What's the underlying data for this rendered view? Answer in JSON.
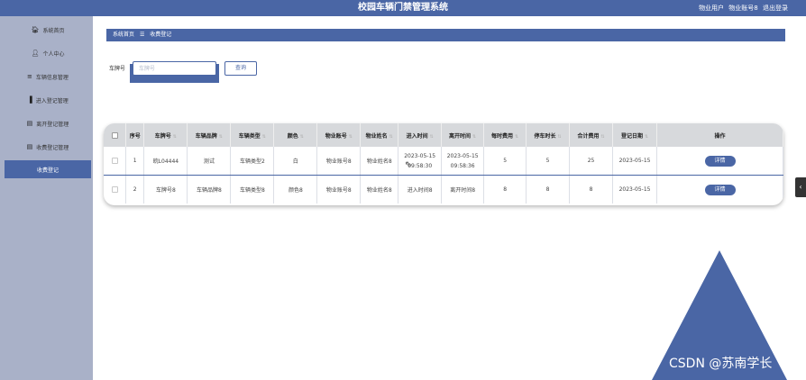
{
  "header": {
    "title": "校园车辆门禁管理系统",
    "user_role": "物业用户",
    "user_name": "物业账号8",
    "logout": "退出登录"
  },
  "sidebar": {
    "items": [
      {
        "label": "系统首页",
        "icon": "home-icon",
        "glyph": "🏠︎"
      },
      {
        "label": "个人中心",
        "icon": "person-icon",
        "glyph": "👤︎"
      },
      {
        "label": "车辆信息管理",
        "icon": "list-icon",
        "glyph": "≡"
      },
      {
        "label": "进入登记管理",
        "icon": "bar-chart-icon",
        "glyph": "▐"
      },
      {
        "label": "离开登记管理",
        "icon": "clipboard-icon",
        "glyph": "▤"
      },
      {
        "label": "收费登记管理",
        "icon": "clipboard-icon",
        "glyph": "▤"
      },
      {
        "label": "收费登记",
        "icon": "",
        "glyph": ""
      }
    ]
  },
  "breadcrumb": {
    "home": "系统首页",
    "sep": "☰",
    "current": "收费登记"
  },
  "search": {
    "label": "车牌号",
    "placeholder": "车牌号",
    "value": "",
    "button": "查询"
  },
  "table": {
    "headers": [
      "序号",
      "车牌号",
      "车辆品牌",
      "车辆类型",
      "颜色",
      "物业账号",
      "物业姓名",
      "进入时间",
      "离开时间",
      "每时费用",
      "停车时长",
      "合计费用",
      "登记日期",
      "操作"
    ],
    "action_label": "详情",
    "rows": [
      {
        "index": "1",
        "plate": "皖L04444",
        "brand": "测试",
        "type": "车辆类型2",
        "color": "白",
        "account": "物业账号8",
        "name": "物业姓名8",
        "enter_date": "2023-05-15",
        "enter_time": "09:58:30",
        "leave_date": "2023-05-15",
        "leave_time": "09:58:36",
        "hourly_fee": "5",
        "duration": "5",
        "total": "25",
        "reg_date": "2023-05-15"
      },
      {
        "index": "2",
        "plate": "车牌号8",
        "brand": "车辆品牌8",
        "type": "车辆类型8",
        "color": "颜色8",
        "account": "物业账号8",
        "name": "物业姓名8",
        "enter_date": "进入时间8",
        "enter_time": "",
        "leave_date": "离开时间8",
        "leave_time": "",
        "hourly_fee": "8",
        "duration": "8",
        "total": "8",
        "reg_date": "2023-05-15"
      }
    ]
  },
  "watermark": "CSDN @苏南学长",
  "colors": {
    "primary": "#4a66a5",
    "sidebar": "#a9b1c8",
    "table_header": "#d7d9dc"
  }
}
